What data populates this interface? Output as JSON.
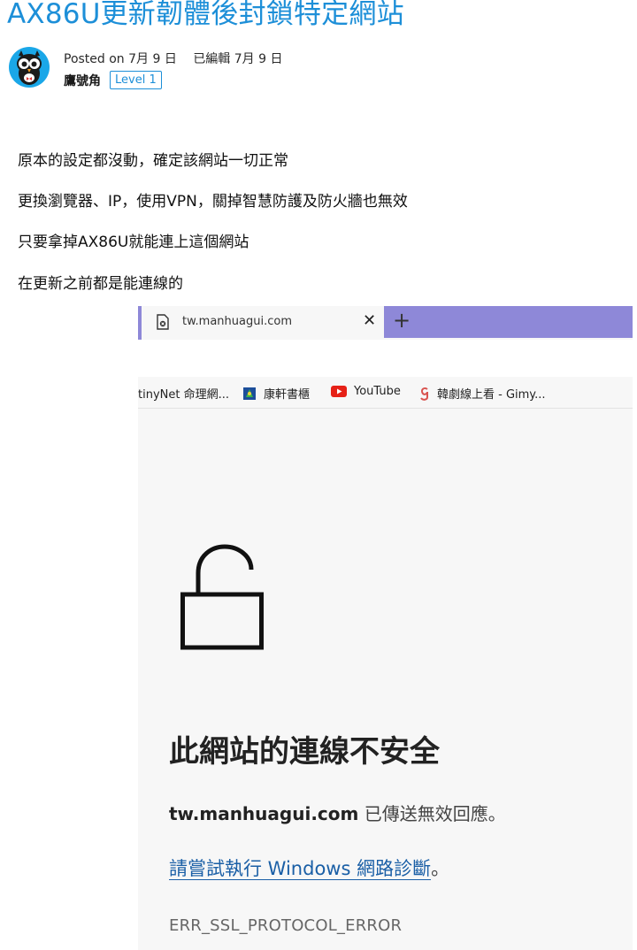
{
  "post": {
    "title": "AX86U更新韌體後封鎖特定網站",
    "posted_on": "Posted on 7月 9 日",
    "edited": "已編輯 7月 9 日",
    "author": "鷹號角",
    "level": "Level 1",
    "lines": [
      "原本的設定都沒動，確定該網站一切正常",
      "更換瀏覽器、IP，使用VPN，關掉智慧防護及防火牆也無效",
      "只要拿掉AX86U就能連上這個網站",
      "在更新之前都是能連線的"
    ]
  },
  "screenshot": {
    "tab_title": "tw.manhuagui.com",
    "tab_close": "✕",
    "new_tab": "+",
    "bookmarks": [
      {
        "label": "tinyNet 命理網...",
        "icon": "none"
      },
      {
        "label": "康軒書櫃",
        "icon": "globe-icon"
      },
      {
        "label": "YouTube",
        "icon": "youtube-icon"
      },
      {
        "label": "韓劇線上看 - Gimy...",
        "icon": "gimy-icon"
      }
    ],
    "error_title": "此網站的連線不安全",
    "error_host": "tw.manhuagui.com",
    "error_host_rest": " 已傳送無效回應。",
    "error_link": "請嘗試執行 Windows 網路診斷",
    "error_link_tail": "。",
    "error_code": "ERR_SSL_PROTOCOL_ERROR"
  },
  "colors": {
    "title_blue": "#1d8fd8",
    "tab_accent": "#8e88d8",
    "link_blue": "#1a5fa6",
    "avatar_bg": "#1aa7e8"
  }
}
